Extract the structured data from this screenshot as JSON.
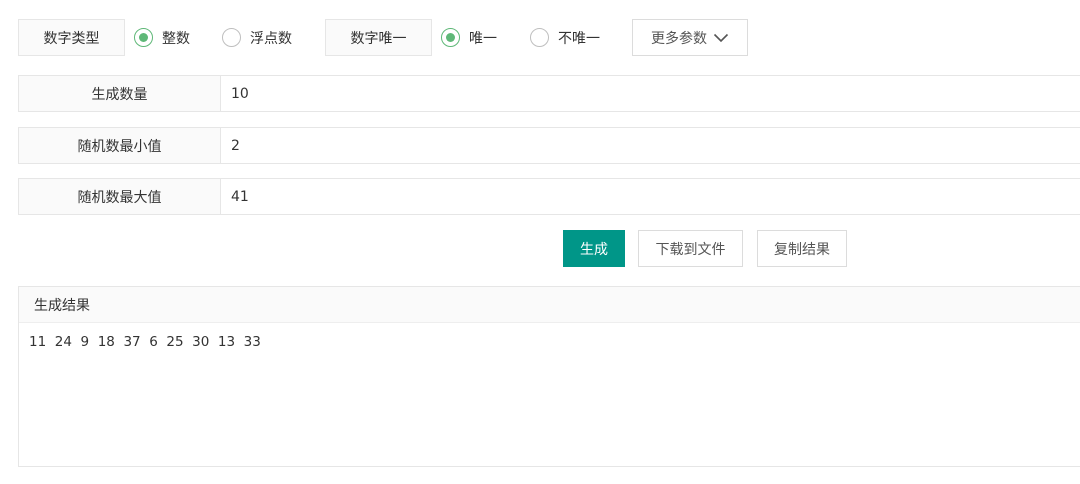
{
  "options": {
    "number_type_label": "数字类型",
    "number_type_choices": [
      {
        "label": "整数",
        "checked": true
      },
      {
        "label": "浮点数",
        "checked": false
      }
    ],
    "unique_label": "数字唯一",
    "unique_choices": [
      {
        "label": "唯一",
        "checked": true
      },
      {
        "label": "不唯一",
        "checked": false
      }
    ],
    "more_params_label": "更多参数"
  },
  "form": {
    "count": {
      "label": "生成数量",
      "value": "10"
    },
    "min": {
      "label": "随机数最小值",
      "value": "2"
    },
    "max": {
      "label": "随机数最大值",
      "value": "41"
    }
  },
  "actions": {
    "generate": "生成",
    "download": "下载到文件",
    "copy": "复制结果"
  },
  "result": {
    "title": "生成结果",
    "text": "11  24  9  18  37  6  25  30  13  33"
  },
  "colors": {
    "primary": "#009688",
    "radio_checked": "#5fb878",
    "border": "#e6e6e6",
    "label_bg": "#fafafa"
  }
}
